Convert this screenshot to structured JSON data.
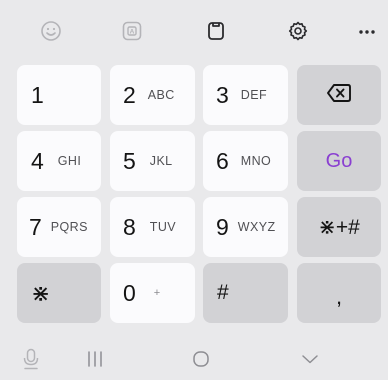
{
  "toolbar": {
    "icons": [
      "emoji-icon",
      "sticker-icon",
      "clipboard-icon",
      "gear-icon",
      "more-icon"
    ],
    "more_label": "···"
  },
  "keys": {
    "k1": {
      "num": "1",
      "letters": ""
    },
    "k2": {
      "num": "2",
      "letters": "ABC"
    },
    "k3": {
      "num": "3",
      "letters": "DEF"
    },
    "k4": {
      "num": "4",
      "letters": "GHI"
    },
    "k5": {
      "num": "5",
      "letters": "JKL"
    },
    "k6": {
      "num": "6",
      "letters": "MNO"
    },
    "k7": {
      "num": "7",
      "letters": "PQRS"
    },
    "k8": {
      "num": "8",
      "letters": "TUV"
    },
    "k9": {
      "num": "9",
      "letters": "WXYZ"
    },
    "star": {
      "label": "⋇"
    },
    "k0": {
      "num": "0",
      "letters": "+"
    },
    "hash": {
      "label": "#"
    },
    "go": {
      "label": "Go"
    },
    "symbols": {
      "label": "⋇+#"
    },
    "comma": {
      "label": ","
    }
  },
  "colors": {
    "go": "#8a3fd1",
    "white_key": "#fbfbfd",
    "gray_key": "#d2d2d5",
    "background": "#e9e9eb",
    "icon_muted": "#b4b4b8",
    "icon_dark": "#2b2b2e"
  },
  "nav": {
    "icons": [
      "microphone-icon",
      "recents-icon",
      "home-icon",
      "back-chevron-icon"
    ]
  }
}
